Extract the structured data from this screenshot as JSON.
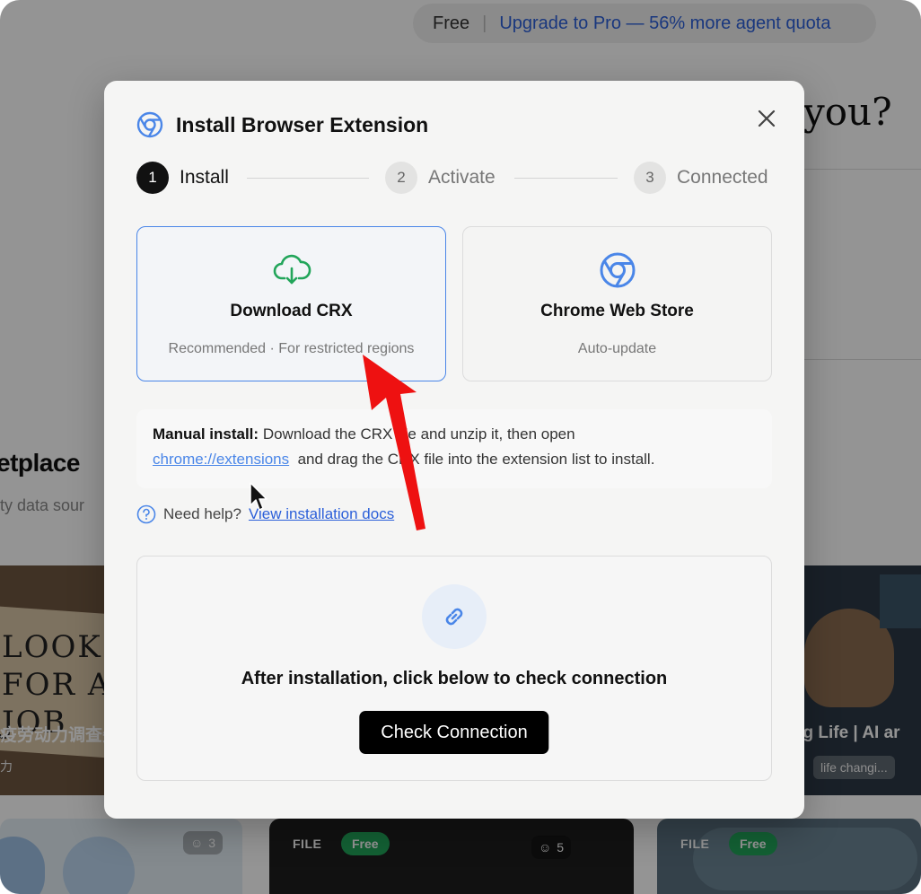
{
  "background": {
    "plan": "Free",
    "separator": "|",
    "upgrade": "Upgrade to Pro — 56% more agent quota",
    "heading_fragment": "you?",
    "marketplace_fragment": "etplace",
    "marketplace_sub_fragment": "ty data sour",
    "left_card": {
      "sign_text": "LOOK\nFOR A\nJOB",
      "title": "疫劳动力调查失",
      "tag": "力"
    },
    "right_card": {
      "title": "ging Life | AI ar",
      "tag": "life changi..."
    },
    "bottom_cards": [
      {
        "count": "3"
      },
      {
        "file": "FILE",
        "free": "Free",
        "count": "5"
      },
      {
        "file": "FILE",
        "free": "Free"
      }
    ]
  },
  "modal": {
    "title": "Install Browser Extension",
    "steps": [
      {
        "num": "1",
        "label": "Install",
        "active": true
      },
      {
        "num": "2",
        "label": "Activate",
        "active": false
      },
      {
        "num": "3",
        "label": "Connected",
        "active": false
      }
    ],
    "options": [
      {
        "title": "Download CRX",
        "subtitle": "Recommended · For restricted regions",
        "selected": true
      },
      {
        "title": "Chrome Web Store",
        "subtitle": "Auto-update",
        "selected": false
      }
    ],
    "manual": {
      "label": "Manual install:",
      "text1": "Download the CRX file and unzip it, then open",
      "link": "chrome://extensions",
      "text2": "and drag the CRX file into the extension list to install."
    },
    "help": {
      "text": "Need help?",
      "link": "View installation docs"
    },
    "connect": {
      "text": "After installation, click below to check connection",
      "button": "Check Connection"
    }
  },
  "colors": {
    "accent": "#4a86e8",
    "download_icon": "#22a55a",
    "primary_button": "#000000"
  }
}
